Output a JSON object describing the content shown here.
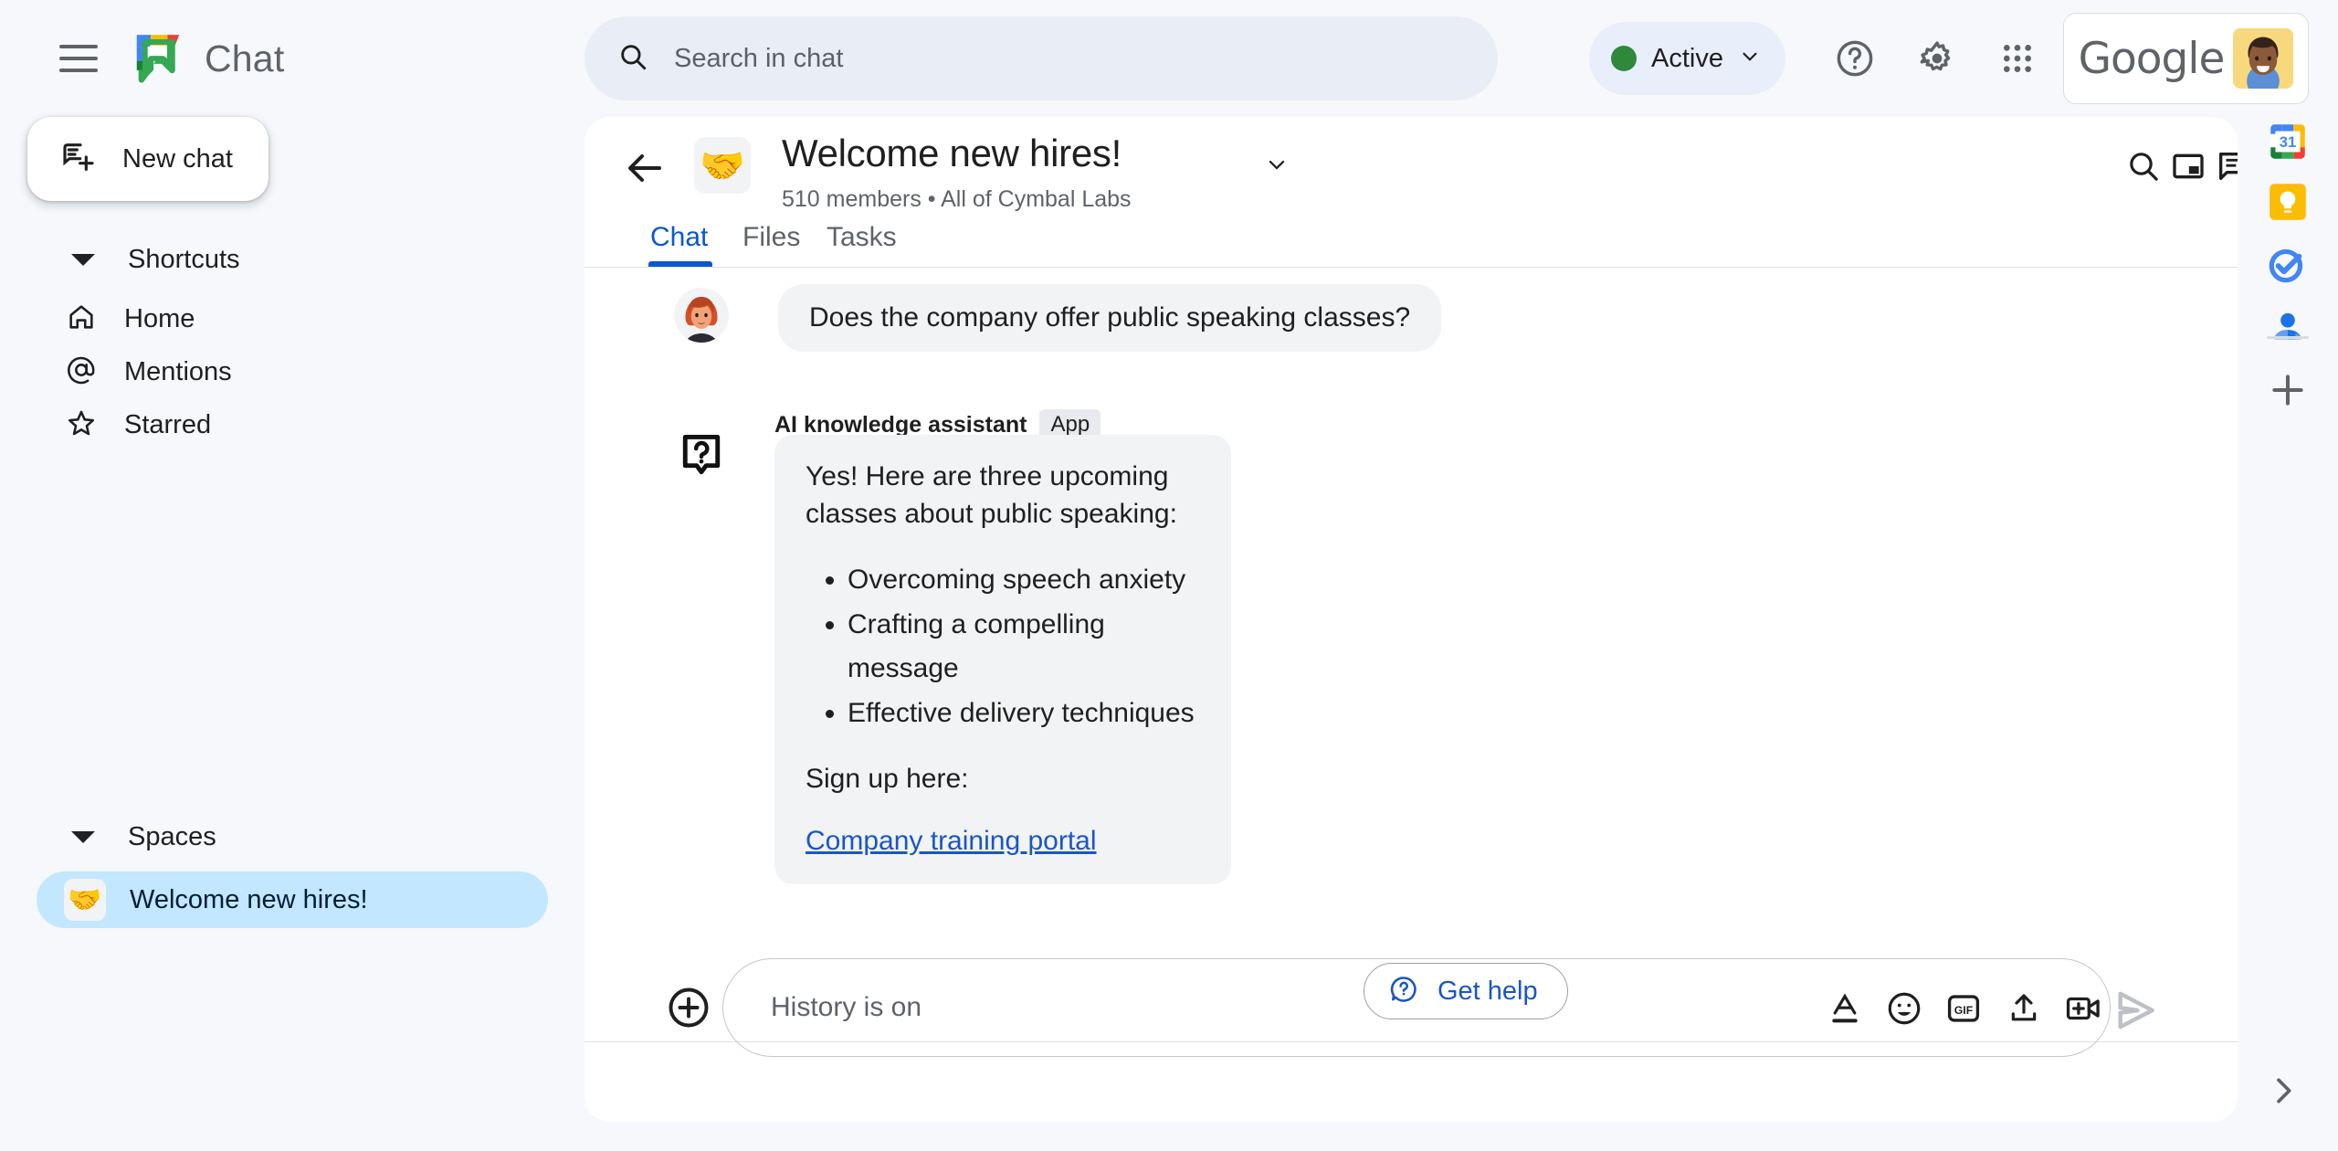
{
  "app": {
    "brand_name": "Chat",
    "logo_icon": "google-chat-logo",
    "menu_icon": "hamburger-menu-icon"
  },
  "search": {
    "placeholder": "Search in chat",
    "icon": "search-icon"
  },
  "status": {
    "label": "Active",
    "dot_color": "#30883c",
    "chevron_icon": "chevron-down-icon"
  },
  "top_actions": [
    {
      "name": "help-icon",
      "label": "Help"
    },
    {
      "name": "gear-icon",
      "label": "Settings"
    },
    {
      "name": "apps-grid-icon",
      "label": "Google apps"
    }
  ],
  "account": {
    "brand_word": "Google",
    "avatar_icon": "user-avatar"
  },
  "sidebar": {
    "new_chat": {
      "label": "New chat",
      "icon": "new-chat-icon"
    },
    "shortcuts": {
      "title": "Shortcuts",
      "items": [
        {
          "label": "Home",
          "icon": "home-icon"
        },
        {
          "label": "Mentions",
          "icon": "at-mention-icon"
        },
        {
          "label": "Starred",
          "icon": "star-icon"
        }
      ]
    },
    "spaces": {
      "title": "Spaces",
      "items": [
        {
          "label": "Welcome new hires!",
          "emoji": "🤝",
          "selected": true
        }
      ]
    }
  },
  "room": {
    "back_icon": "back-arrow-icon",
    "emoji": "🤝",
    "title": "Welcome new hires!",
    "title_chevron_icon": "chevron-down-icon",
    "members": "510 members",
    "separator": "•",
    "org": "All of Cymbal Labs",
    "subtitle": "510 members  •  All of Cymbal Labs",
    "actions": [
      {
        "name": "search-in-space-icon",
        "label": "Search in space"
      },
      {
        "name": "picture-in-picture-icon",
        "label": "Open in split view"
      },
      {
        "name": "chat-bubble-icon",
        "label": "Chat view"
      }
    ],
    "tabs": [
      {
        "label": "Chat",
        "active": true
      },
      {
        "label": "Files",
        "active": false
      },
      {
        "label": "Tasks",
        "active": false
      }
    ]
  },
  "conversation": {
    "messages": [
      {
        "sender": "user",
        "avatar_icon": "woman-avatar",
        "text": "Does the company offer public speaking classes?"
      },
      {
        "sender": "app",
        "app_name": "AI knowledge assistant",
        "app_badge": "App",
        "app_icon": "question-mark-app-icon",
        "intro": "Yes! Here are three upcoming classes about public speaking:",
        "bullets": [
          "Overcoming speech anxiety",
          "Crafting a compelling message",
          "Effective delivery techniques"
        ],
        "signup_text": "Sign up here:",
        "link_text": "Company training portal"
      }
    ],
    "get_help_button": {
      "label": "Get help",
      "icon": "help-chat-icon",
      "color": "#1a56c5"
    }
  },
  "composer": {
    "add_icon": "plus-circle-icon",
    "placeholder": "History is on",
    "actions": [
      {
        "name": "format-text-icon",
        "label": "Format"
      },
      {
        "name": "emoji-icon",
        "label": "Emoji"
      },
      {
        "name": "gif-icon",
        "label": "GIF"
      },
      {
        "name": "upload-file-icon",
        "label": "Upload file"
      },
      {
        "name": "add-video-meeting-icon",
        "label": "Add video meeting"
      }
    ],
    "send_icon": "send-icon"
  },
  "right_rail": {
    "items": [
      {
        "name": "google-calendar-icon",
        "label": "Calendar",
        "badge": "31"
      },
      {
        "name": "google-keep-icon",
        "label": "Keep"
      },
      {
        "name": "google-tasks-icon",
        "label": "Tasks"
      },
      {
        "name": "google-contacts-icon",
        "label": "Contacts"
      }
    ],
    "add_label": "Get Add-ons",
    "add_icon": "plus-icon",
    "expand_icon": "chevron-right-icon"
  },
  "colors": {
    "page_bg": "#f6f8fc",
    "panel_bg": "#ffffff",
    "accent_blue": "#0b57d0",
    "link_blue": "#1a56c5",
    "selected_space": "#c2e7ff",
    "bubble_gray": "#f1f3f4"
  }
}
